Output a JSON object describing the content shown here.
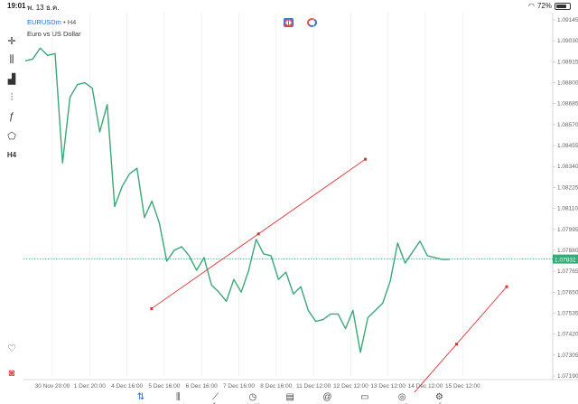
{
  "status_bar": {
    "time": "19:01",
    "date": "พ. 13 ธ.ค.",
    "battery": "72%",
    "battery_level": 0.72
  },
  "chart": {
    "symbol": "EURUSDm",
    "timeframe": "H4",
    "timeframe_separator": " • ",
    "description": "Euro vs US Dollar",
    "current_price": "1.07832",
    "colors": {
      "line": "#3aa877",
      "trendline": "#e03030",
      "price_tag": "#3aa877",
      "grid": "#e8e8e8",
      "axis_text": "#666666",
      "bid_line": "#3aa877"
    }
  },
  "left_toolbar": [
    {
      "name": "crosshair-icon",
      "glyph": "✛"
    },
    {
      "name": "candlestick-icon",
      "glyph": "⫼"
    },
    {
      "name": "indicators-icon",
      "glyph": "▟"
    },
    {
      "name": "settings-sliders-icon",
      "glyph": "⫶"
    },
    {
      "name": "function-icon",
      "glyph": "ƒ"
    },
    {
      "name": "objects-icon",
      "glyph": "⬠"
    },
    {
      "name": "timeframe-label",
      "glyph": "H4"
    }
  ],
  "chart_data": {
    "type": "line",
    "x_ticks": [
      "30 Nov 20:00",
      "1 Dec 20:00",
      "4 Dec 16:00",
      "5 Dec 16:00",
      "6 Dec 16:00",
      "7 Dec 16:00",
      "8 Dec 16:00",
      "11 Dec 12:00",
      "12 Dec 12:00",
      "13 Dec 12:00",
      "14 Dec 12:00",
      "15 Dec 12:00"
    ],
    "y_ticks": [
      "1.09145",
      "1.09030",
      "1.08915",
      "1.08800",
      "1.08685",
      "1.08570",
      "1.08455",
      "1.08340",
      "1.08225",
      "1.08110",
      "1.07995",
      "1.07880",
      "1.07765",
      "1.07650",
      "1.07535",
      "1.07420",
      "1.07305",
      "1.07190"
    ],
    "ylim": [
      1.0719,
      1.09145
    ],
    "series": [
      {
        "values": [
          1.0892,
          1.0893,
          1.0899,
          1.0895,
          1.0896,
          1.0836,
          1.0872,
          1.0879,
          1.088,
          1.0877,
          1.0853,
          1.0868,
          1.0812,
          1.0823,
          1.083,
          1.0833,
          1.0806,
          1.0815,
          1.0803,
          1.0782,
          1.0788,
          1.079,
          1.0785,
          1.0777,
          1.0784,
          1.0769,
          1.0765,
          1.076,
          1.0772,
          1.0765,
          1.0777,
          1.0794,
          1.0786,
          1.0785,
          1.0772,
          1.0776,
          1.0764,
          1.0768,
          1.0755,
          1.0749,
          1.075,
          1.0753,
          1.0753,
          1.0745,
          1.0755,
          1.0732,
          1.0751,
          1.0755,
          1.0759,
          1.0771,
          1.0792,
          1.0781,
          1.0787,
          1.0793,
          1.0785,
          1.0784,
          1.0783,
          1.0783
        ]
      }
    ],
    "trendlines": [
      {
        "from": [
          0.242,
          1.0756
        ],
        "to": [
          0.646,
          1.0838
        ]
      },
      {
        "from": [
          0.0,
          1.0705
        ],
        "to": [
          0.913,
          1.0768
        ]
      }
    ],
    "grid": "vertical"
  },
  "tabs": [
    {
      "name": "tab-quotes",
      "label": "ราคา",
      "glyph": "⇅",
      "active": true
    },
    {
      "name": "tab-chart",
      "label": "กราฟ",
      "glyph": "⫼",
      "active": false
    },
    {
      "name": "tab-trade",
      "label": "การซื้อขาย",
      "glyph": "⟋",
      "active": false
    },
    {
      "name": "tab-history",
      "label": "ประวัติ",
      "glyph": "◷",
      "active": false
    },
    {
      "name": "tab-news",
      "label": "ข่าว",
      "glyph": "▤",
      "active": false
    },
    {
      "name": "tab-mailbox",
      "label": "กล่องจดหมาย",
      "glyph": "@",
      "active": false
    },
    {
      "name": "tab-chat",
      "label": "แชท",
      "glyph": "▭",
      "active": false
    },
    {
      "name": "tab-account",
      "label": "บัญชี",
      "glyph": "◎",
      "active": false
    },
    {
      "name": "tab-settings",
      "label": "การตั้งค่า",
      "glyph": "⚙",
      "active": false
    }
  ]
}
